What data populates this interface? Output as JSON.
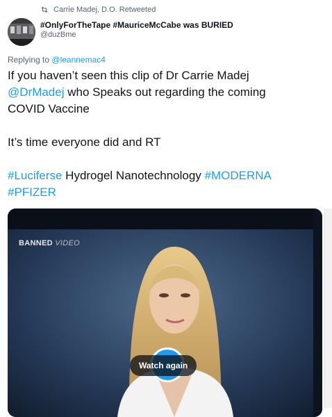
{
  "retweet": {
    "text": "Carrie Madej, D.O. Retweeted",
    "icon": "retweet-icon"
  },
  "author": {
    "display_name": "#OnlyForTheTape #MauriceMcCabe was BURIED",
    "handle": "@duzBme"
  },
  "reply": {
    "prefix": "Replying to",
    "mention": "@leannemac4"
  },
  "tweet": {
    "line1_text": "If you haven’t seen this clip of  Dr Carrie Madej",
    "line2_mention": "@DrMadej",
    "line2_text": " who Speaks out regarding the coming",
    "line3_text": "COVID Vaccine",
    "para2": "It’s time everyone did and RT",
    "hashtag1": "#Luciferse",
    "mid_text": " Hydrogel Nanotechnology ",
    "hashtag2": "#MODERNA",
    "hashtag3": "#PFIZER"
  },
  "media": {
    "label_bold": "BANNED",
    "label_italic": "VIDEO",
    "watch_again": "Watch again"
  },
  "colors": {
    "link": "#1d9bf0",
    "secondary": "#536471",
    "text": "#0f1419"
  }
}
